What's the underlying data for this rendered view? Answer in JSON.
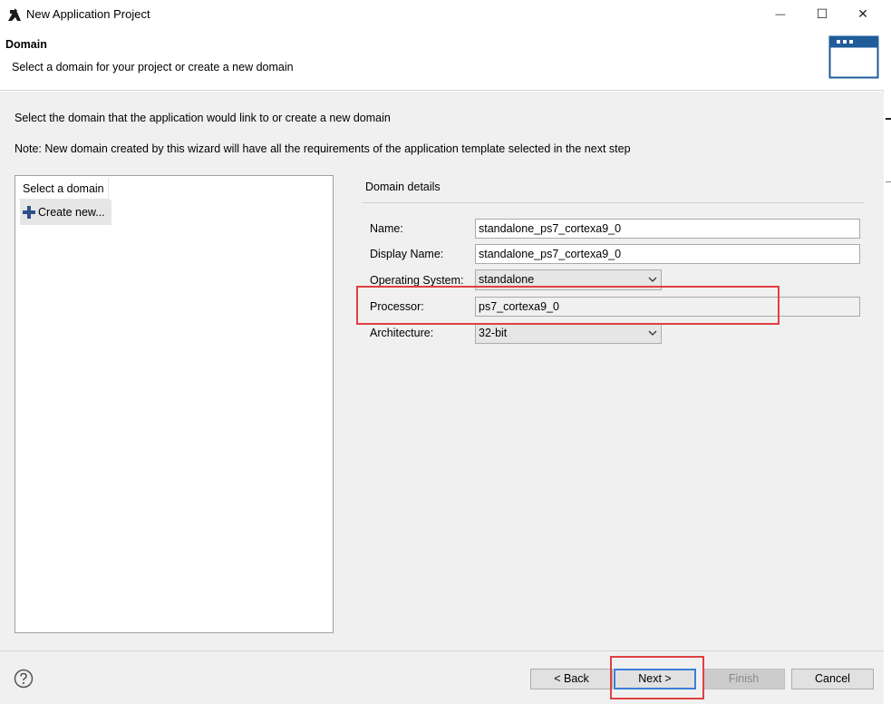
{
  "window": {
    "title": "New Application Project",
    "controls": {
      "minimize": "—",
      "maximize": "☐",
      "close": "✕"
    }
  },
  "header": {
    "title": "Domain",
    "subtitle": "Select a domain for your project or create a new domain"
  },
  "body": {
    "intro": "Select the domain that the application would link to or create a new domain",
    "note": "Note: New domain created by this wizard will have all the requirements of the application template selected in the next step"
  },
  "domain_list": {
    "header": "Select a domain",
    "create_new_label": "Create new..."
  },
  "details": {
    "title": "Domain details",
    "name_label": "Name:",
    "name_value": "standalone_ps7_cortexa9_0",
    "display_name_label": "Display Name:",
    "display_name_value": "standalone_ps7_cortexa9_0",
    "os_label": "Operating System:",
    "os_value": "standalone",
    "processor_label": "Processor:",
    "processor_value": "ps7_cortexa9_0",
    "architecture_label": "Architecture:",
    "architecture_value": "32-bit"
  },
  "footer": {
    "back_label": "< Back",
    "next_label": "Next >",
    "finish_label": "Finish",
    "cancel_label": "Cancel"
  },
  "colors": {
    "highlight": "#e04040",
    "accent": "#3c7fd8",
    "panel_bg": "#f0f0f0"
  }
}
